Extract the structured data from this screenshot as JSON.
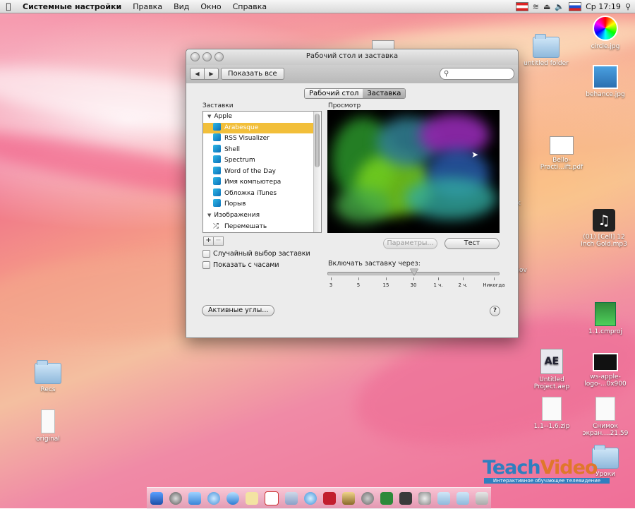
{
  "menubar": {
    "app_name": "Системные настройки",
    "items": [
      "Правка",
      "Вид",
      "Окно",
      "Справка"
    ],
    "clock": "Ср 17:19"
  },
  "window": {
    "title": "Рабочий стол и заставка",
    "show_all": "Показать все",
    "search_placeholder": "",
    "tabs": [
      {
        "label": "Рабочий стол",
        "selected": false
      },
      {
        "label": "Заставка",
        "selected": true
      }
    ],
    "list_label": "Заставки",
    "preview_label": "Просмотр",
    "screensavers": [
      {
        "label": "Apple",
        "type": "group"
      },
      {
        "label": "Arabesque",
        "type": "item",
        "selected": true
      },
      {
        "label": "RSS Visualizer",
        "type": "item"
      },
      {
        "label": "Shell",
        "type": "item"
      },
      {
        "label": "Spectrum",
        "type": "item"
      },
      {
        "label": "Word of the Day",
        "type": "item"
      },
      {
        "label": "Имя компьютера",
        "type": "item"
      },
      {
        "label": "Обложка iTunes",
        "type": "item"
      },
      {
        "label": "Порыв",
        "type": "item"
      },
      {
        "label": "Изображения",
        "type": "group"
      },
      {
        "label": "Перемешать",
        "type": "shuffle"
      }
    ],
    "add_label": "+",
    "remove_label": "−",
    "random_checkbox": "Случайный выбор заставки",
    "clock_checkbox": "Показать с часами",
    "options_button": "Параметры...",
    "test_button": "Тест",
    "start_after_label": "Включать заставку через:",
    "slider_ticks": [
      "3",
      "5",
      "15",
      "30",
      "1 ч.",
      "2 ч.",
      "Никогда"
    ],
    "slider_value": "30",
    "hot_corners_button": "Активные углы...",
    "help_label": "?"
  },
  "desktop_icons": [
    {
      "label": "circle.jpg"
    },
    {
      "label": "untitled folder"
    },
    {
      "label": "behance.jpg"
    },
    {
      "label": "Bello-Practi...ift.pdf"
    },
    {
      "label": "(01) [Cell] 12 Inch Gold.mp3"
    },
    {
      "label": "1.1.cmproj"
    },
    {
      "label": "Untitled Project.aep"
    },
    {
      "label": "ws-apple-logo-...0x900"
    },
    {
      "label": "1.1--1.6.zip"
    },
    {
      "label": "Снимок экран....21.59"
    },
    {
      "label": "Уроки"
    },
    {
      "label": "Recs"
    },
    {
      "label": "original"
    },
    {
      "label": "ack"
    },
    {
      "label": "mov"
    }
  ],
  "watermark": {
    "brand_a": "Teach",
    "brand_b": "Video",
    "tagline": "Интерактивное обучающее телевидение"
  }
}
